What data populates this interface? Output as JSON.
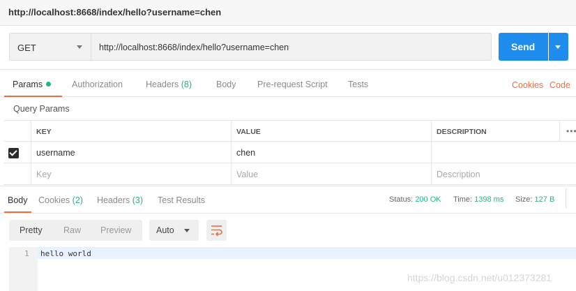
{
  "window": {
    "title": "http://localhost:8668/index/hello?username=chen"
  },
  "request": {
    "method": "GET",
    "url": "http://localhost:8668/index/hello?username=chen",
    "send_label": "Send"
  },
  "request_tabs": {
    "params": "Params",
    "authorization": "Authorization",
    "headers": "Headers",
    "headers_count": "(8)",
    "body": "Body",
    "pre_request": "Pre-request Script",
    "tests": "Tests",
    "cookies_link": "Cookies",
    "code_link": "Code"
  },
  "query_params": {
    "title": "Query Params",
    "headers": {
      "key": "KEY",
      "value": "VALUE",
      "description": "DESCRIPTION"
    },
    "rows": [
      {
        "key": "username",
        "value": "chen",
        "description": "",
        "checked": true
      }
    ],
    "placeholders": {
      "key": "Key",
      "value": "Value",
      "description": "Description"
    }
  },
  "response": {
    "tabs": {
      "body": "Body",
      "cookies": "Cookies",
      "cookies_count": "(2)",
      "headers": "Headers",
      "headers_count": "(3)",
      "test_results": "Test Results"
    },
    "status_label": "Status:",
    "status_value": "200 OK",
    "time_label": "Time:",
    "time_value": "1398 ms",
    "size_label": "Size:",
    "size_value": "127 B",
    "format_options": [
      "Pretty",
      "Raw",
      "Preview"
    ],
    "format_selected": "Pretty",
    "auto_label": "Auto",
    "lines": [
      {
        "number": "1",
        "text": "hello world"
      }
    ]
  },
  "watermark": "https://blog.csdn.net/u012373281",
  "colors": {
    "accent_blue": "#1f8ded",
    "accent_orange": "#f26b3a",
    "status_green": "#26b47f"
  }
}
